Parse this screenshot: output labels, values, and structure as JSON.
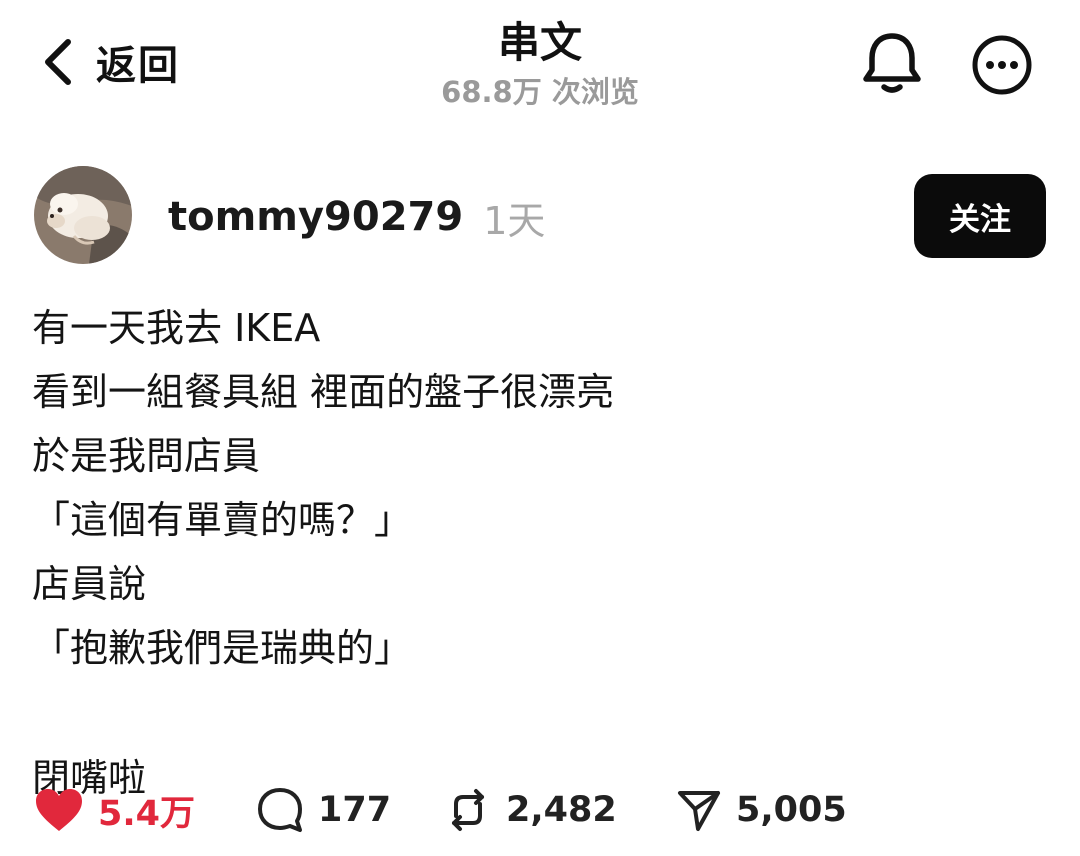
{
  "header": {
    "back_label": "返回",
    "title": "串文",
    "views": "68.8万 次浏览",
    "icons": [
      "chevron-left-icon",
      "bell-icon",
      "more-icon"
    ]
  },
  "post": {
    "author": {
      "username": "tommy90279",
      "time": "1天",
      "follow_label": "关注"
    },
    "lines": [
      "有一天我去 IKEA",
      "看到一組餐具組 裡面的盤子很漂亮",
      "於是我問店員",
      "「這個有單賣的嗎？」",
      "店員說",
      "「抱歉我們是瑞典的」"
    ],
    "closing": "閉嘴啦"
  },
  "actions": {
    "likes": "5.4万",
    "comments": "177",
    "reposts": "2,482",
    "shares": "5,005"
  },
  "colors": {
    "like": "#e1283c",
    "follow_bg": "#0b0b0b",
    "muted_text": "#9a9a9a"
  }
}
